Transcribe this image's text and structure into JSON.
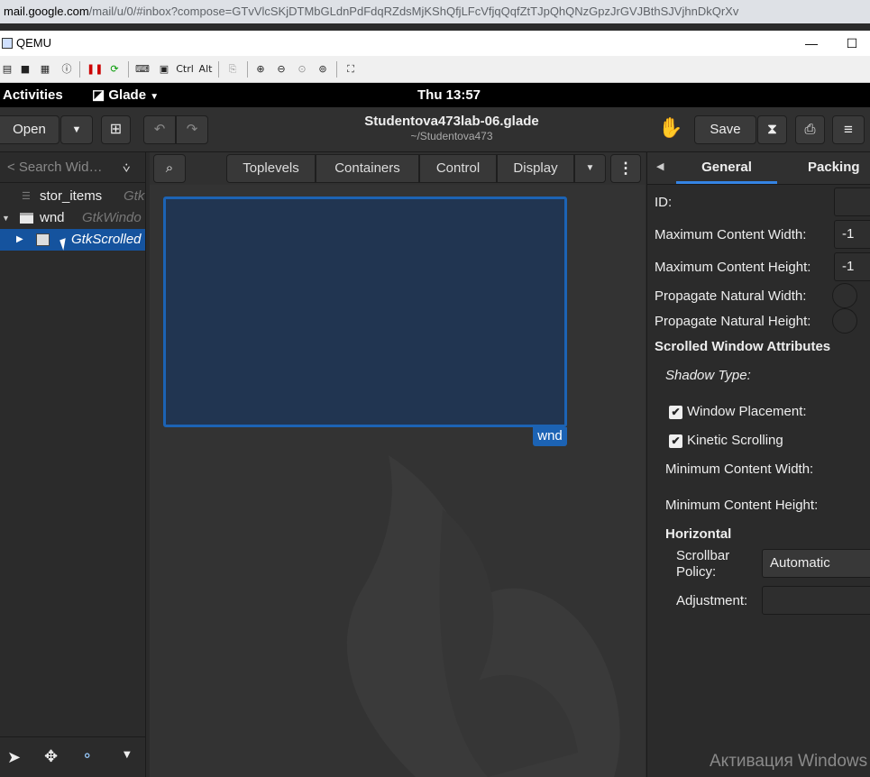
{
  "browser": {
    "url_host": "mail.google.com",
    "url_path": "/mail/u/0/#inbox?compose=GTvVlcSKjDTMbGLdnPdFdqRZdsMjKShQfjLFcVfjqQqfZtTJpQhQNzGpzJrGVJBthSJVjhnDkQrXv"
  },
  "qemu": {
    "title": "QEMU",
    "minimize": "—",
    "maximize": "☐",
    "toolbar_ctrl": "Ctrl",
    "toolbar_alt": "Alt"
  },
  "gnome": {
    "activities": "Activities",
    "app_name": "Glade",
    "clock": "Thu 13:57"
  },
  "header": {
    "open_label": "Open",
    "title": "Studentova473lab-06.glade",
    "subtitle": "~/Studentova473",
    "save_label": "Save"
  },
  "left_panel": {
    "search_placeholder": "< Search Wid…",
    "tree": [
      {
        "name": "stor_items",
        "type": "Gtk"
      },
      {
        "name": "wnd",
        "type": "GtkWindo"
      },
      {
        "name": "",
        "type": "GtkScrolled"
      }
    ]
  },
  "center": {
    "tabs": [
      "Toplevels",
      "Containers",
      "Control",
      "Display"
    ],
    "window_label": "wnd"
  },
  "right_panel": {
    "tabs": [
      "General",
      "Packing"
    ],
    "props": {
      "id_label": "ID:",
      "max_width_label": "Maximum Content Width:",
      "max_width_value": "-1",
      "max_height_label": "Maximum Content Height:",
      "max_height_value": "-1",
      "prop_width_label": "Propagate Natural Width:",
      "prop_height_label": "Propagate Natural Height:",
      "section_title": "Scrolled Window Attributes",
      "shadow_label": "Shadow Type:",
      "window_placement_label": "Window Placement:",
      "kinetic_label": "Kinetic Scrolling",
      "min_width_label": "Minimum Content Width:",
      "min_height_label": "Minimum Content Height:",
      "horizontal_title": "Horizontal",
      "scrollbar_policy_label_1": "Scrollbar",
      "scrollbar_policy_label_2": "Policy:",
      "scrollbar_policy_value": "Automatic",
      "adjustment_label": "Adjustment:"
    }
  },
  "overlay": {
    "activation_text": "Активация Windows"
  }
}
